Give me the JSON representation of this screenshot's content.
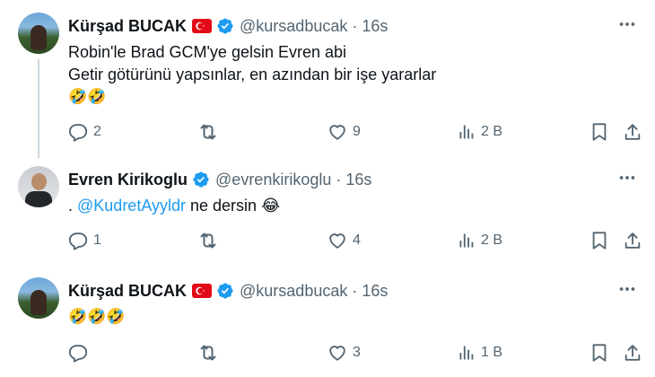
{
  "tweets": [
    {
      "name": "Kürşad BUCAK",
      "handle": "@kursadbucak",
      "dot": "·",
      "time": "16s",
      "lines": [
        "Robin'le Brad GCM'ye gelsin Evren abi",
        "Getir götürünü yapsınlar, en azından bir işe yararlar"
      ],
      "emoji": "🤣🤣",
      "replies": "2",
      "retweets": "",
      "likes": "9",
      "views": "2 B",
      "avatar_icon": "avatar-landscape"
    },
    {
      "name": "Evren Kirikoglu",
      "handle": "@evrenkirikoglu",
      "dot": "·",
      "time": "16s",
      "prefix": ". ",
      "mention": "@KudretAyyldr",
      "suffix": " ne dersin 😂",
      "replies": "1",
      "retweets": "",
      "likes": "4",
      "views": "2 B",
      "avatar_icon": "avatar-person"
    },
    {
      "name": "Kürşad BUCAK",
      "handle": "@kursadbucak",
      "dot": "·",
      "time": "16s",
      "emoji": "🤣🤣🤣",
      "replies": "",
      "retweets": "",
      "likes": "3",
      "views": "1 B",
      "avatar_icon": "avatar-landscape"
    }
  ],
  "colors": {
    "accent": "#1d9bf0",
    "muted": "#536471",
    "text": "#0f1419",
    "flag": "#e30a17"
  },
  "icons": [
    "turkey-flag-icon",
    "verified-badge-icon",
    "more-icon",
    "reply-icon",
    "retweet-icon",
    "like-icon",
    "views-icon",
    "bookmark-icon",
    "share-icon"
  ]
}
